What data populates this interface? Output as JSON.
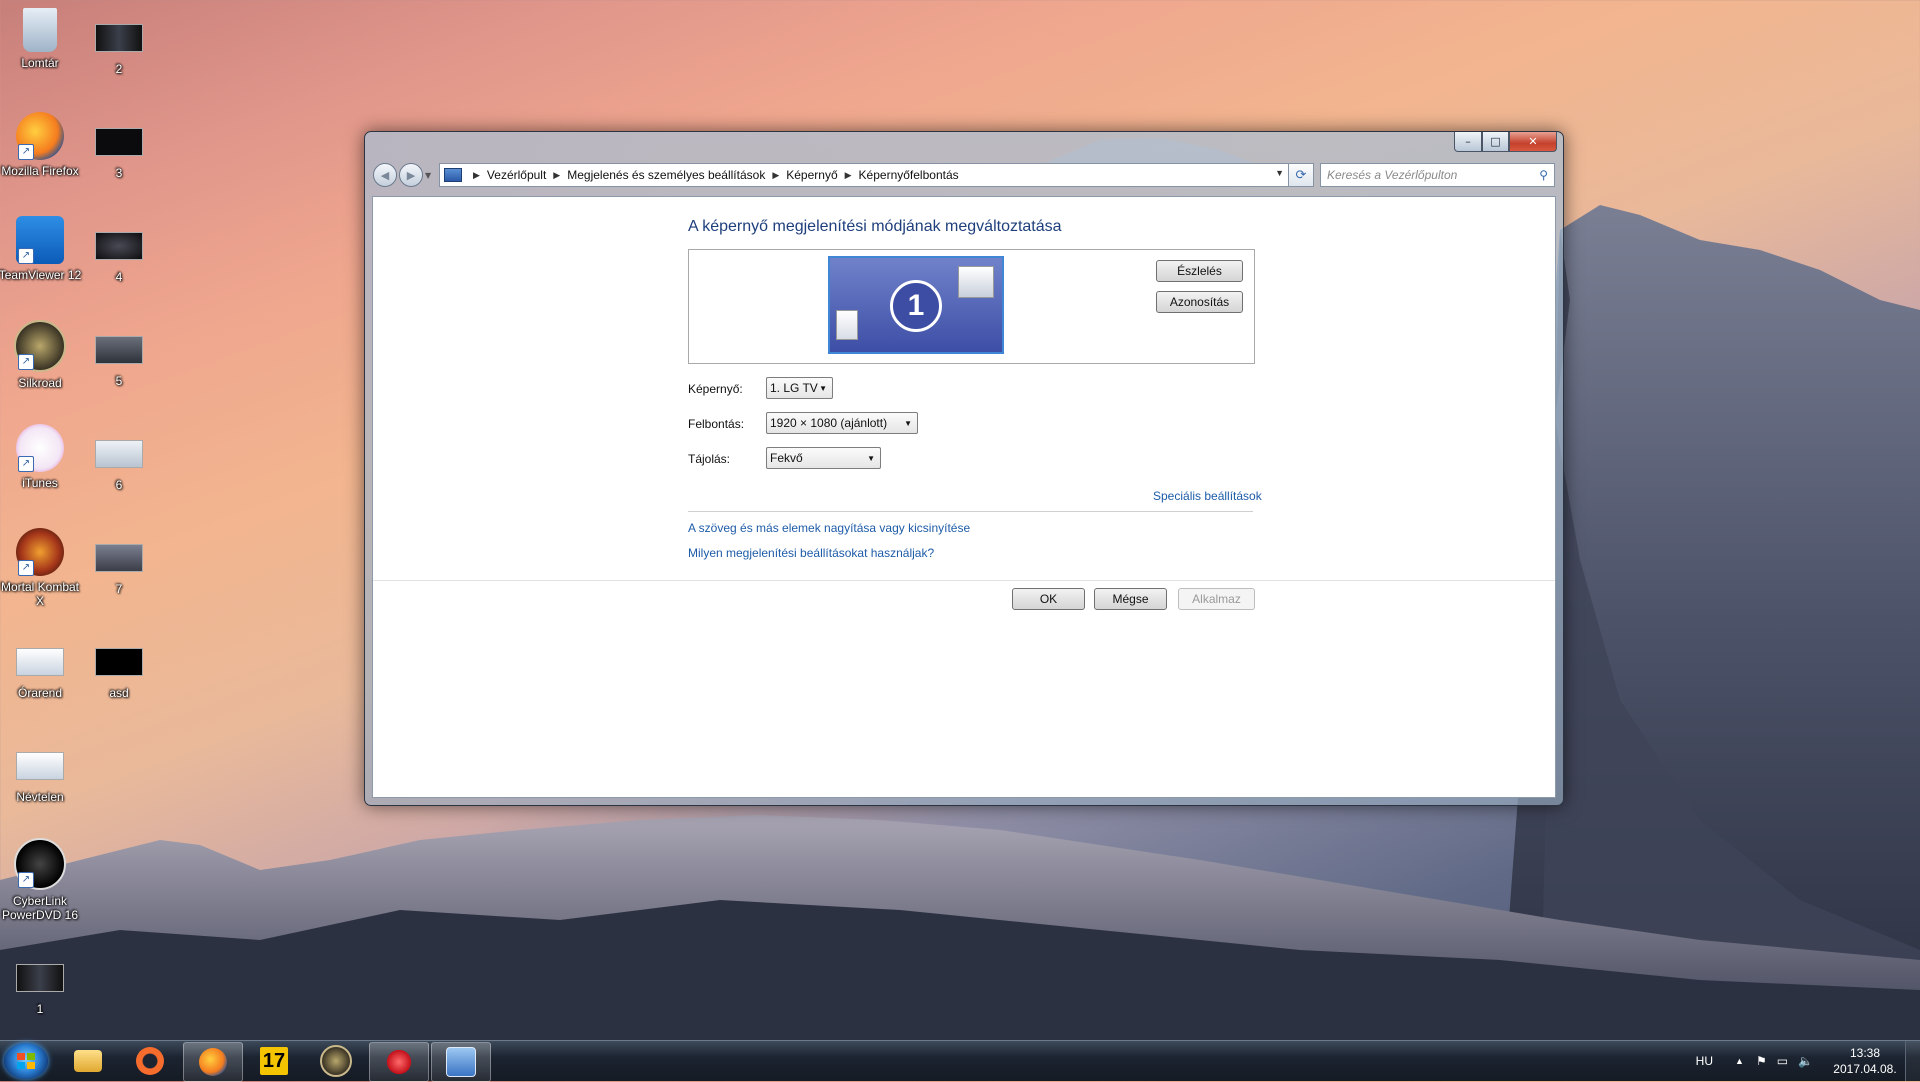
{
  "desktop": {
    "icons": [
      {
        "label": "Lomtár"
      },
      {
        "label": "2"
      },
      {
        "label": "Mozilla Firefox"
      },
      {
        "label": "3"
      },
      {
        "label": "TeamViewer 12"
      },
      {
        "label": "4"
      },
      {
        "label": "Silkroad"
      },
      {
        "label": "5"
      },
      {
        "label": "iTunes"
      },
      {
        "label": "6"
      },
      {
        "label": "Mortal Kombat X"
      },
      {
        "label": "7"
      },
      {
        "label": "Órarend"
      },
      {
        "label": "asd"
      },
      {
        "label": "Névtelen"
      },
      {
        "label": "CyberLink PowerDVD 16"
      },
      {
        "label": "1"
      }
    ]
  },
  "window": {
    "controls": {
      "minimize": "–",
      "maximize": "□",
      "close": "✕"
    },
    "nav": {
      "back": "◀",
      "forward": "▶"
    },
    "breadcrumb": [
      "Vezérlőpult",
      "Megjelenés és személyes beállítások",
      "Képernyő",
      "Képernyőfelbontás"
    ],
    "search_placeholder": "Keresés a Vezérlőpulton",
    "heading": "A képernyő megjelenítési módjának megváltoztatása",
    "monitor_number": "1",
    "detect_button": "Észlelés",
    "identify_button": "Azonosítás",
    "fields": {
      "display_label": "Képernyő:",
      "display_value": "1. LG TV",
      "resolution_label": "Felbontás:",
      "resolution_value": "1920 × 1080 (ajánlott)",
      "orientation_label": "Tájolás:",
      "orientation_value": "Fekvő"
    },
    "advanced_link": "Speciális beállítások",
    "links": [
      "A szöveg és más elemek nagyítása vagy kicsinyítése",
      "Milyen megjelenítési beállításokat használjak?"
    ],
    "ok_button": "OK",
    "cancel_button": "Mégse",
    "apply_button": "Alkalmaz"
  },
  "taskbar": {
    "language": "HU",
    "time": "13:38",
    "date": "2017.04.08."
  },
  "colors": {
    "accent": "#1e3f7c",
    "link": "#1e5ca8",
    "monitor": "#3d4ea6"
  }
}
